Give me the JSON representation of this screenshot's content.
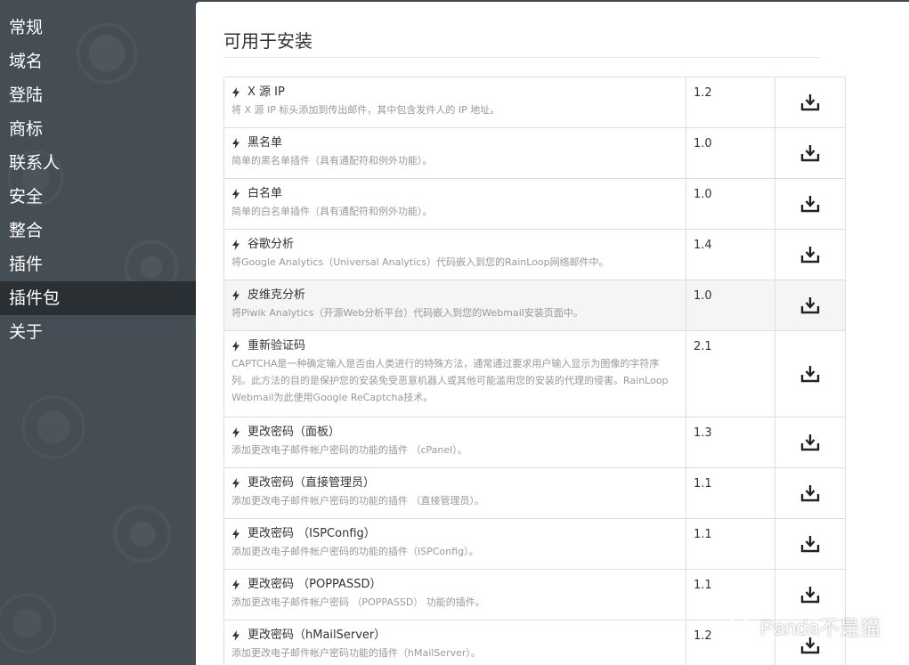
{
  "sidebar": {
    "items": [
      {
        "label": "常规",
        "active": false
      },
      {
        "label": "域名",
        "active": false
      },
      {
        "label": "登陆",
        "active": false
      },
      {
        "label": "商标",
        "active": false
      },
      {
        "label": "联系人",
        "active": false
      },
      {
        "label": "安全",
        "active": false
      },
      {
        "label": "整合",
        "active": false
      },
      {
        "label": "插件",
        "active": false
      },
      {
        "label": "插件包",
        "active": true
      },
      {
        "label": "关于",
        "active": false
      }
    ]
  },
  "main": {
    "title": "可用于安装",
    "plugins": [
      {
        "name": "X 源 IP",
        "desc": "将 X 源 IP 标头添加到传出邮件，其中包含发件人的 IP 地址。",
        "version": "1.2"
      },
      {
        "name": "黑名单",
        "desc": "简单的黑名单插件（具有通配符和例外功能）。",
        "version": "1.0"
      },
      {
        "name": "白名单",
        "desc": "简单的白名单插件（具有通配符和例外功能）。",
        "version": "1.0"
      },
      {
        "name": "谷歌分析",
        "desc": "将Google Analytics（Universal Analytics）代码嵌入到您的RainLoop网络邮件中。",
        "version": "1.4"
      },
      {
        "name": "皮维克分析",
        "desc": "将Piwik Analytics（开源Web分析平台）代码嵌入到您的Webmail安装页面中。",
        "version": "1.0"
      },
      {
        "name": "重新验证码",
        "desc": "CAPTCHA是一种确定输入是否由人类进行的特殊方法，通常通过要求用户输入显示为图像的字符序列。此方法的目的是保护您的安装免受恶意机器人或其他可能滥用您的安装的代理的侵害。RainLoop Webmail为此使用Google ReCaptcha技术。",
        "version": "2.1"
      },
      {
        "name": "更改密码（面板）",
        "desc": "添加更改电子邮件帐户密码的功能的插件 （cPanel）。",
        "version": "1.3"
      },
      {
        "name": "更改密码（直接管理员）",
        "desc": "添加更改电子邮件帐户密码的功能的插件 （直接管理员）。",
        "version": "1.1"
      },
      {
        "name": "更改密码 （ISPConfig）",
        "desc": "添加更改电子邮件帐户密码的功能的插件（ISPConfig）。",
        "version": "1.1"
      },
      {
        "name": "更改密码 （POPPASSD）",
        "desc": "添加更改电子邮件帐户密码 （POPPASSD） 功能的插件。",
        "version": "1.1"
      },
      {
        "name": "更改密码（hMailServer）",
        "desc": "添加更改电子邮件帐户密码功能的插件（hMailServer）。",
        "version": "1.2"
      }
    ]
  },
  "watermark": {
    "text": "Panda不是猫",
    "icon": "wechat-icon"
  },
  "icons": {
    "plugin": "bolt-icon",
    "action": "download-icon"
  }
}
